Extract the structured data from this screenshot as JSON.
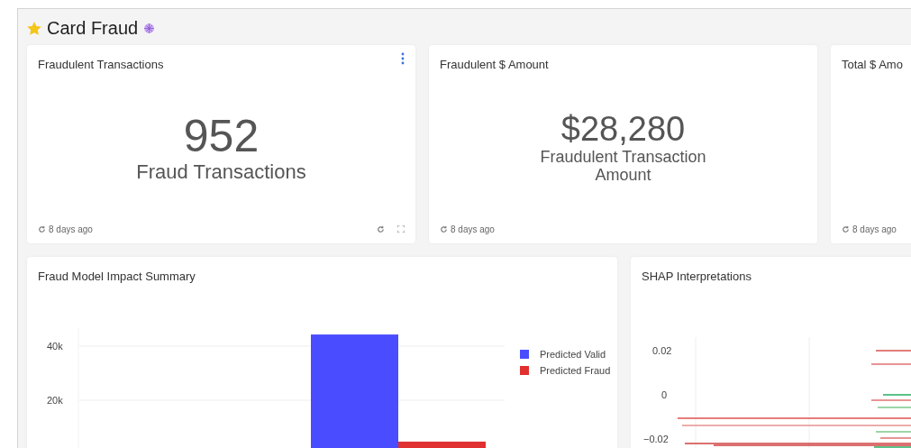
{
  "dashboard": {
    "title": "Card Fraud",
    "favorite": true
  },
  "kpi_cards": [
    {
      "title": "Fraudulent Transactions",
      "value": "952",
      "caption": "Fraud Transactions",
      "updated": "8 days ago",
      "actions": true
    },
    {
      "title": "Fraudulent $ Amount",
      "value": "$28,280",
      "caption": "Fraudulent Transaction Amount",
      "updated": "8 days ago",
      "actions": false
    },
    {
      "title": "Total $ Amo",
      "updated": "8 days ago",
      "actions": false
    }
  ],
  "impact_card": {
    "title": "Fraud Model Impact Summary",
    "chart_data": {
      "type": "bar",
      "legend": "right",
      "ylim": [
        0,
        46600
      ],
      "yticks": [
        {
          "value": 20000,
          "label": "20k"
        },
        {
          "value": 40000,
          "label": "40k"
        }
      ],
      "series": [
        {
          "name": "Predicted Valid",
          "color": "#4a4cff",
          "values": [
            44300
          ]
        },
        {
          "name": "Predicted Fraud",
          "color": "#e03030",
          "values": [
            4700
          ]
        }
      ]
    }
  },
  "shap_card": {
    "title": "SHAP Interpretations",
    "y_ticks": [
      "0.02",
      "0",
      "−0.02"
    ]
  }
}
